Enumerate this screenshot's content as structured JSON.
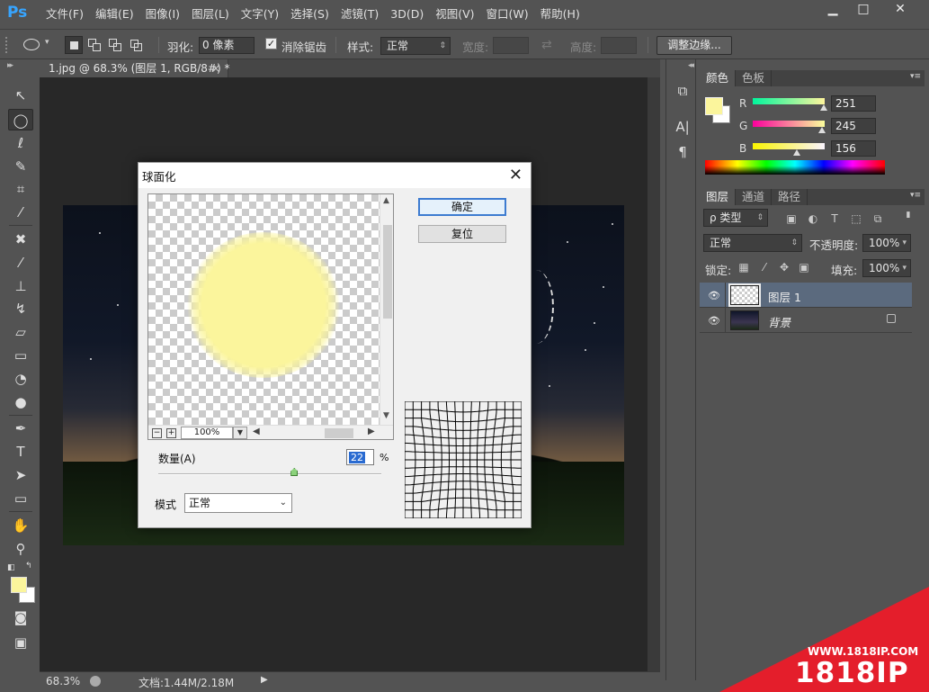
{
  "app": {
    "logo": "Ps"
  },
  "menu": [
    "文件(F)",
    "编辑(E)",
    "图像(I)",
    "图层(L)",
    "文字(Y)",
    "选择(S)",
    "滤镜(T)",
    "3D(D)",
    "视图(V)",
    "窗口(W)",
    "帮助(H)"
  ],
  "window_buttons": {
    "minimize": "▁",
    "maximize": "□",
    "close": "✕"
  },
  "options": {
    "feather_label": "羽化:",
    "feather_value": "0 像素",
    "antialias_label": "消除锯齿",
    "antialias_checked": true,
    "style_label": "样式:",
    "style_value": "正常",
    "width_label": "宽度:",
    "height_label": "高度:",
    "refine_edge": "调整边缘..."
  },
  "document": {
    "tab_title": "1.jpg @ 68.3% (图层 1, RGB/8#) *",
    "tab_close": "×",
    "zoom": "68.3%",
    "doc_info": "文档:1.44M/2.18M"
  },
  "color_panel": {
    "tabs": [
      "颜色",
      "色板"
    ],
    "foreground": "#fbf59c",
    "background": "#ffffff",
    "r_label": "R",
    "r_value": "251",
    "g_label": "G",
    "g_value": "245",
    "b_label": "B",
    "b_value": "156"
  },
  "layers_panel": {
    "tabs": [
      "图层",
      "通道",
      "路径"
    ],
    "filter_kind": "ρ 类型",
    "blend_mode": "正常",
    "opacity_label": "不透明度:",
    "opacity_value": "100%",
    "lock_label": "锁定:",
    "fill_label": "填充:",
    "fill_value": "100%",
    "layers": [
      {
        "name": "图层 1",
        "selected": true
      },
      {
        "name": "背景",
        "selected": false,
        "locked": true
      }
    ]
  },
  "dialog": {
    "title": "球面化",
    "ok": "确定",
    "reset": "复位",
    "zoom": "100%",
    "amount_label": "数量(A)",
    "amount_value": "22",
    "amount_unit": "%",
    "amount_fraction": 0.61,
    "mode_label": "模式",
    "mode_value": "正常"
  },
  "watermark": {
    "url": "WWW.1818IP.COM",
    "brand": "1818IP"
  },
  "colors": {
    "accent_layer": "#5b6a7e",
    "watermark_red": "#e41e2b",
    "ps_blue": "#37a5ff"
  }
}
